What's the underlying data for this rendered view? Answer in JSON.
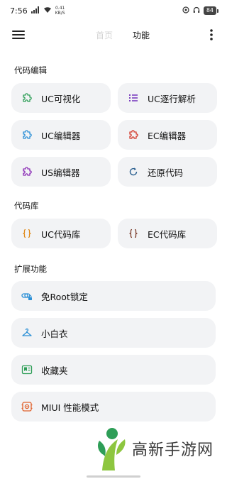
{
  "status_bar": {
    "time": "7:56",
    "net_speed_value": "0.41",
    "net_speed_unit": "KB/S",
    "battery": "84"
  },
  "appbar": {
    "tabs": [
      "首页",
      "功能"
    ],
    "active_tab": "功能"
  },
  "sections": {
    "code_edit": {
      "title": "代码编辑",
      "items": [
        {
          "label": "UC可视化",
          "icon": "puzzle-icon",
          "color": "#2e9e57"
        },
        {
          "label": "UC逐行解析",
          "icon": "list-icon",
          "color": "#7b3fbf"
        },
        {
          "label": "UC编辑器",
          "icon": "puzzle-icon",
          "color": "#2b8fd6"
        },
        {
          "label": "EC编辑器",
          "icon": "puzzle-icon",
          "color": "#d23a2c"
        },
        {
          "label": "US编辑器",
          "icon": "puzzle-icon",
          "color": "#8a2bb5"
        },
        {
          "label": "还原代码",
          "icon": "refresh-icon",
          "color": "#2a5f8f"
        }
      ]
    },
    "code_lib": {
      "title": "代码库",
      "items": [
        {
          "label": "UC代码库",
          "icon": "braces-icon",
          "color": "#e08a1a"
        },
        {
          "label": "EC代码库",
          "icon": "braces-icon",
          "color": "#7a3b2a"
        }
      ]
    },
    "extensions": {
      "title": "扩展功能",
      "items": [
        {
          "label": "免Root锁定",
          "icon": "link-lock-icon",
          "color": "#2b8fd6"
        },
        {
          "label": "小白衣",
          "icon": "hanger-icon",
          "color": "#2b8fd6"
        },
        {
          "label": "收藏夹",
          "icon": "bookmark-icon",
          "color": "#2e9e57"
        },
        {
          "label": "MIUI 性能模式",
          "icon": "performance-icon",
          "color": "#e0602a"
        }
      ]
    }
  },
  "watermark": {
    "text": "高新手游网",
    "logo_colors": [
      "#8dc63f",
      "#2e9e57"
    ]
  }
}
